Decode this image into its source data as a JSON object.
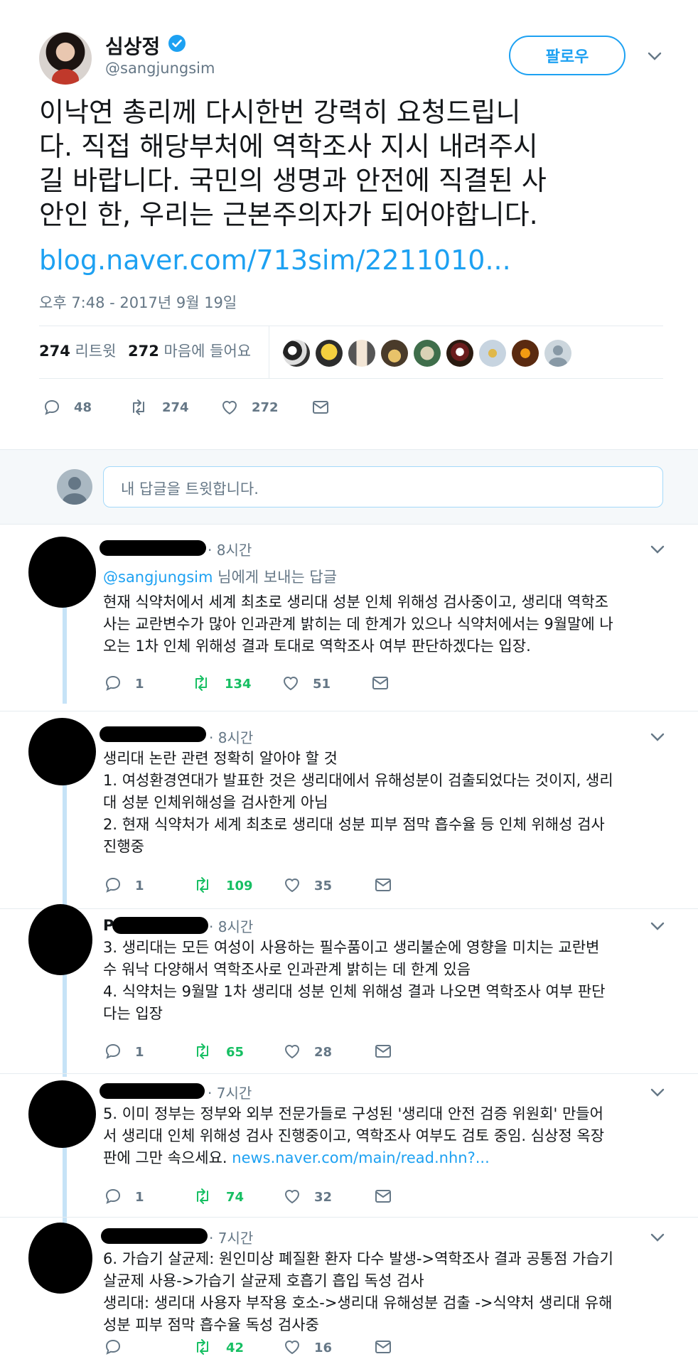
{
  "header": {
    "name": "심상정",
    "handle": "@sangjungsim",
    "follow_label": "팔로우"
  },
  "tweet": {
    "text_lines": [
      "이낙연 총리께 다시한번 강력히 요청드립니",
      "다. 직접 해당부처에 역학조사 지시 내려주시",
      "길 바랍니다. 국민의 생명과 안전에 직결된 사",
      "안인 한, 우리는 근본주의자가 되어야합니다."
    ],
    "link": "blog.naver.com/713sim/2211010...",
    "timestamp": "오후 7:48 - 2017년 9월 19일",
    "retweets": "274",
    "retweets_label": "리트윗",
    "likes": "272",
    "likes_label": "마음에 들어요",
    "reply_count": "48",
    "retweet_count": "274",
    "like_count": "272"
  },
  "reply_box": {
    "placeholder": "내 답글을 트윗합니다."
  },
  "colors": {
    "accent": "#1da1f2",
    "retweet_green": "#17bf63",
    "muted": "#657786"
  },
  "replies": [
    {
      "time": "· 8시간",
      "reply_to_handle": "@sangjungsim",
      "reply_to_suffix": " 님에게 보내는 답글",
      "lines": [
        "현재 식약처에서 세계 최초로 생리대 성분 인체 위해성 검사중이고, 생리대 역학조",
        "사는 교란변수가 많아 인과관계 밝히는 데 한계가 있으나 식약처에서는 9월말에 나",
        "오는 1차 인체 위해성 결과 토대로 역학조사 여부 판단하겠다는 입장."
      ],
      "replies": "1",
      "retweets": "134",
      "likes": "51"
    },
    {
      "time": "· 8시간",
      "lines": [
        "생리대 논란 관련 정확히 알아야 할 것",
        "1. 여성환경연대가 발표한 것은 생리대에서 유해성분이 검출되었다는 것이지, 생리",
        "대 성분 인체위해성을 검사한게 아님",
        "2. 현재 식약처가 세계 최초로 생리대 성분 피부 점막 흡수율 등 인체 위해성 검사",
        "진행중"
      ],
      "replies": "1",
      "retweets": "109",
      "likes": "35"
    },
    {
      "name_prefix": "P",
      "time": "· 8시간",
      "lines": [
        "3. 생리대는 모든 여성이 사용하는 필수품이고 생리불순에 영향을 미치는 교란변",
        "수 워낙 다양해서 역학조사로 인과관계 밝히는 데 한계 있음",
        "4. 식약처는 9월말 1차 생리대 성분 인체 위해성 결과 나오면 역학조사 여부 판단",
        "다는 입장"
      ],
      "replies": "1",
      "retweets": "65",
      "likes": "28"
    },
    {
      "time": "· 7시간",
      "lines": [
        "5. 이미 정부는 정부와 외부 전문가들로 구성된 '생리대 안전 검증 위원회' 만들어",
        "서 생리대 인체 위해성 검사 진행중이고, 역학조사 여부도 검토 중임. 심상정 옥장",
        "판에 그만 속으세요."
      ],
      "link": "news.naver.com/main/read.nhn?...",
      "replies": "1",
      "retweets": "74",
      "likes": "32"
    },
    {
      "time": "· 7시간",
      "lines": [
        "6. 가습기 살균제: 원인미상 폐질환 환자 다수 발생->역학조사 결과 공통점 가습기",
        "살균제 사용->가습기 살균제 호흡기 흡입 독성 검사",
        "생리대: 생리대 사용자 부작용 호소->생리대 유해성분 검출 ->식약처 생리대 유해",
        "성분 피부 점막 흡수율 독성 검사중"
      ],
      "retweets": "42",
      "likes": "16"
    }
  ]
}
